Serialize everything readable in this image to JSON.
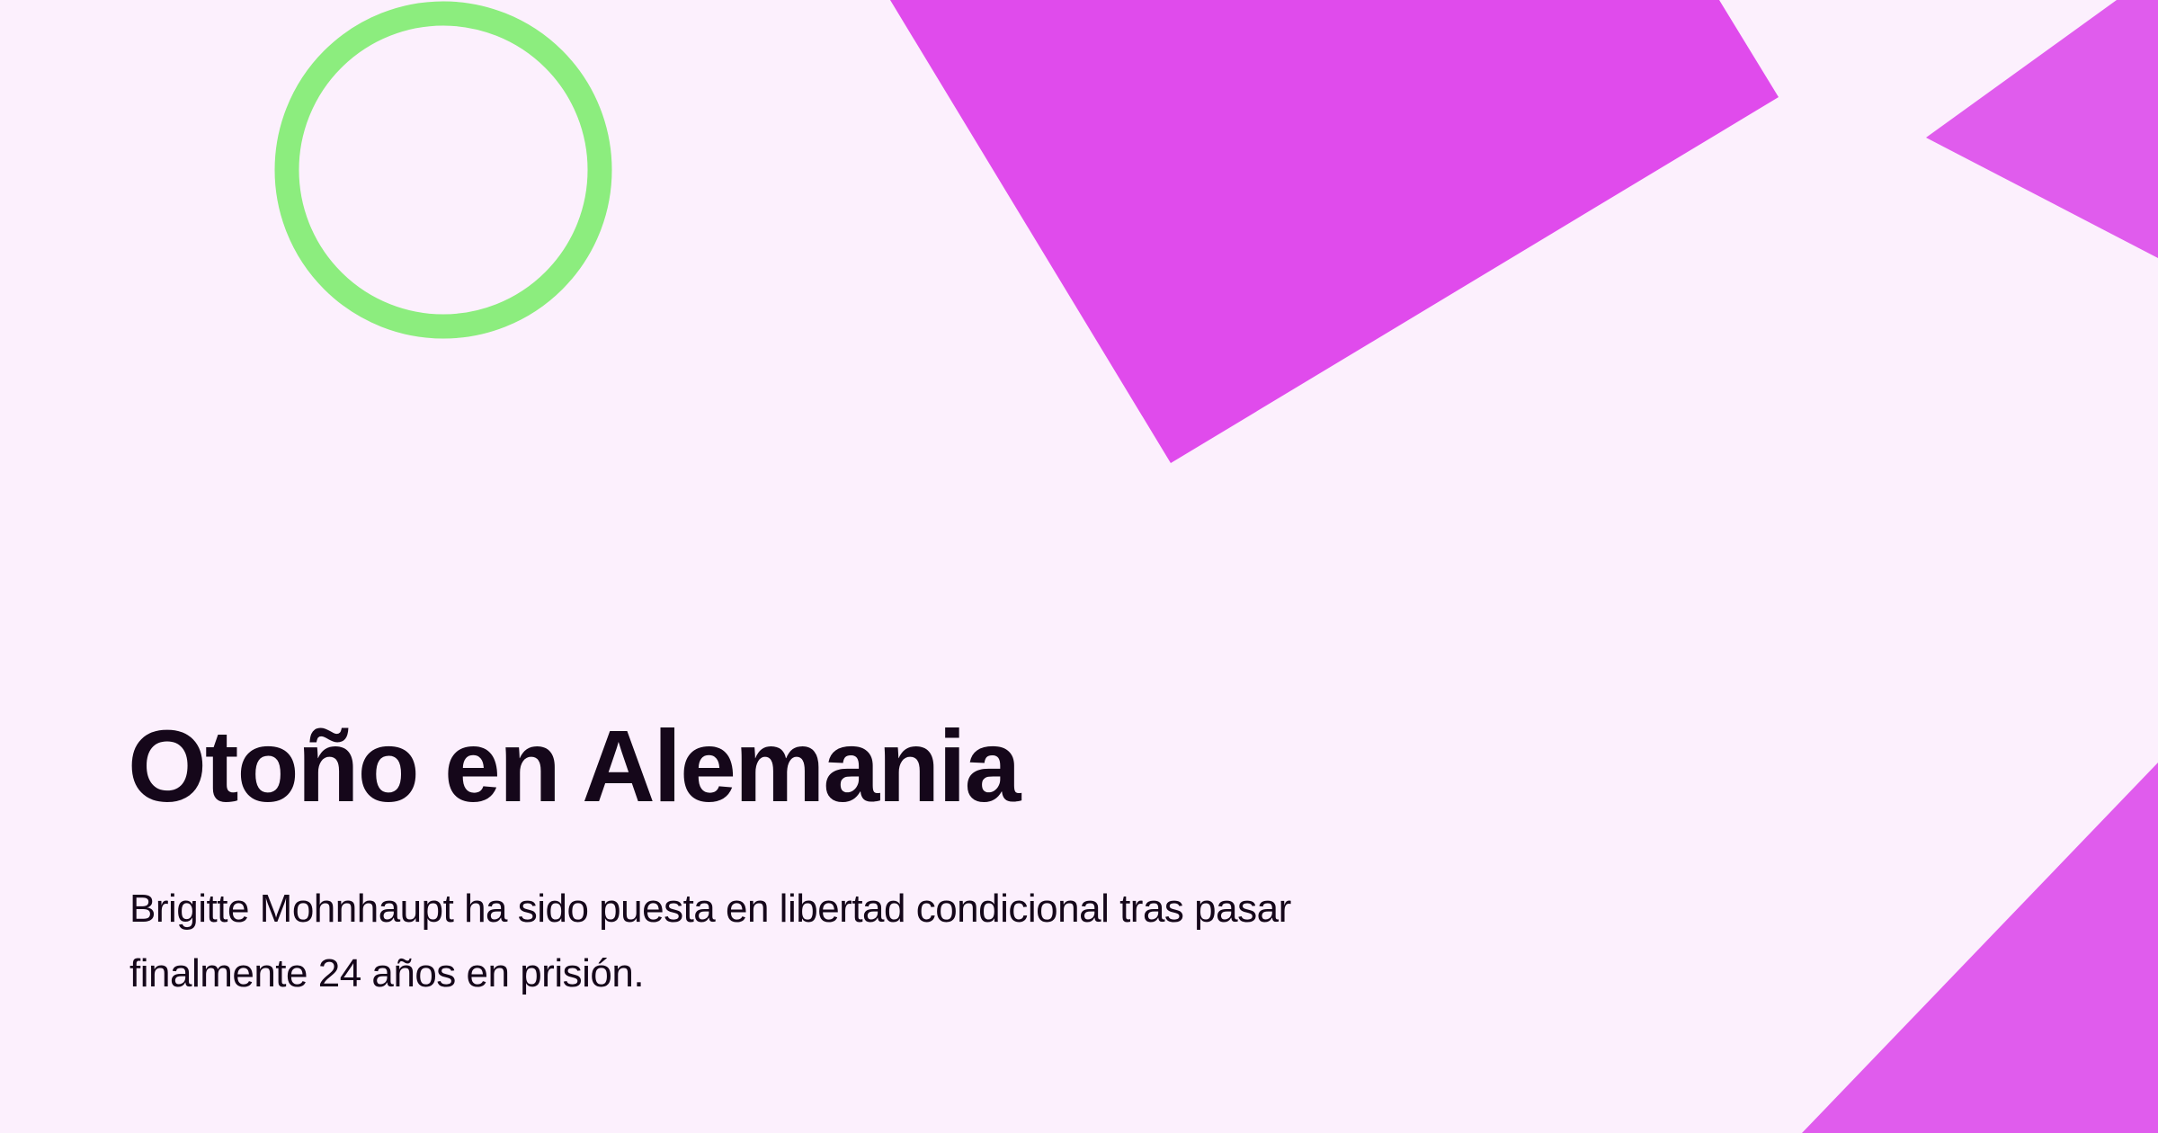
{
  "card": {
    "title": "Otoño en Alemania",
    "description": "Brigitte Mohnhaupt ha sido puesta en libertad condicional tras pasar finalmente 24 años en prisión."
  },
  "decorations": [
    {
      "shape": "ring",
      "color": "#8ced7e"
    },
    {
      "shape": "triangle",
      "color": "#e04bec"
    },
    {
      "shape": "triangle",
      "color": "#e05ced"
    },
    {
      "shape": "triangle",
      "color": "#e05ced"
    }
  ],
  "colors": {
    "background": "#fcf0fd",
    "text": "#15071a"
  }
}
